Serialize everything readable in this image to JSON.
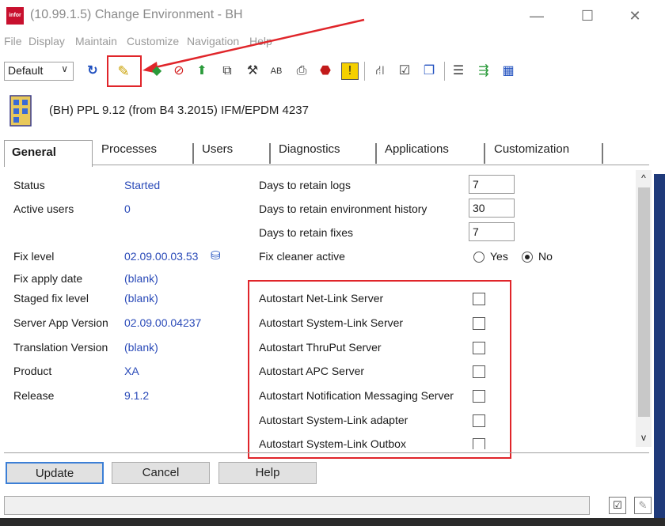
{
  "window": {
    "title": "(10.99.1.5) Change Environment - BH",
    "app_icon_text": "infor",
    "minimize": "—",
    "maximize": "☐",
    "close": "✕"
  },
  "menu": [
    "File",
    "Display",
    "Maintain",
    "Customize",
    "Navigation",
    "Help"
  ],
  "toolbar": {
    "view_value": "Default",
    "icons": [
      "refresh-icon",
      "pencil-icon",
      "green-shape-icon",
      "stop-icon",
      "green-arrow-icon",
      "copy-icon",
      "tools-icon",
      "ab-icon",
      "printer-icon",
      "stop-sign-icon",
      "info-icon",
      "tree-icon",
      "checklist-icon",
      "window-icon",
      "list-icon",
      "export-icon",
      "grid-icon"
    ]
  },
  "environment": {
    "text": "(BH)   PPL 9.12 (from B4 3.2015) IFM/EPDM  4237"
  },
  "tabs": [
    "General",
    "Processes",
    "Users",
    "Diagnostics",
    "Applications",
    "Customization"
  ],
  "left_fields": [
    {
      "label": "Status",
      "value": "Started"
    },
    {
      "label": "Active users",
      "value": "0"
    },
    {
      "label": "Fix level",
      "value": "02.09.00.03.53"
    },
    {
      "label": "Fix apply date",
      "value": "(blank)"
    },
    {
      "label": "Staged fix level",
      "value": "(blank)"
    },
    {
      "label": "Server App Version",
      "value": "02.09.00.04237"
    },
    {
      "label": "Translation  Version",
      "value": "(blank)"
    },
    {
      "label": "Product",
      "value": "XA"
    },
    {
      "label": "Release",
      "value": "9.1.2"
    }
  ],
  "right_fields": [
    {
      "label": "Days to retain logs",
      "value": "7"
    },
    {
      "label": "Days to retain environment history",
      "value": "30"
    },
    {
      "label": "Days to retain fixes",
      "value": "7"
    }
  ],
  "fix_cleaner": {
    "label": "Fix cleaner active",
    "yes": "Yes",
    "no": "No",
    "selected": "No"
  },
  "autostart": [
    {
      "label": "Autostart Net-Link Server",
      "checked": false
    },
    {
      "label": "Autostart System-Link Server",
      "checked": false
    },
    {
      "label": "Autostart ThruPut Server",
      "checked": false
    },
    {
      "label": "Autostart APC Server",
      "checked": false
    },
    {
      "label": "Autostart Notification Messaging Server",
      "checked": false
    },
    {
      "label": "Autostart System-Link adapter",
      "checked": false
    },
    {
      "label": "Autostart System-Link Outbox",
      "checked": false
    }
  ],
  "buttons": {
    "update": "Update",
    "cancel": "Cancel",
    "help": "Help"
  },
  "scroll": {
    "up": "^",
    "down": "v"
  },
  "colors": {
    "annotation_red": "#e0252a",
    "value_blue": "#2a4ab8"
  }
}
